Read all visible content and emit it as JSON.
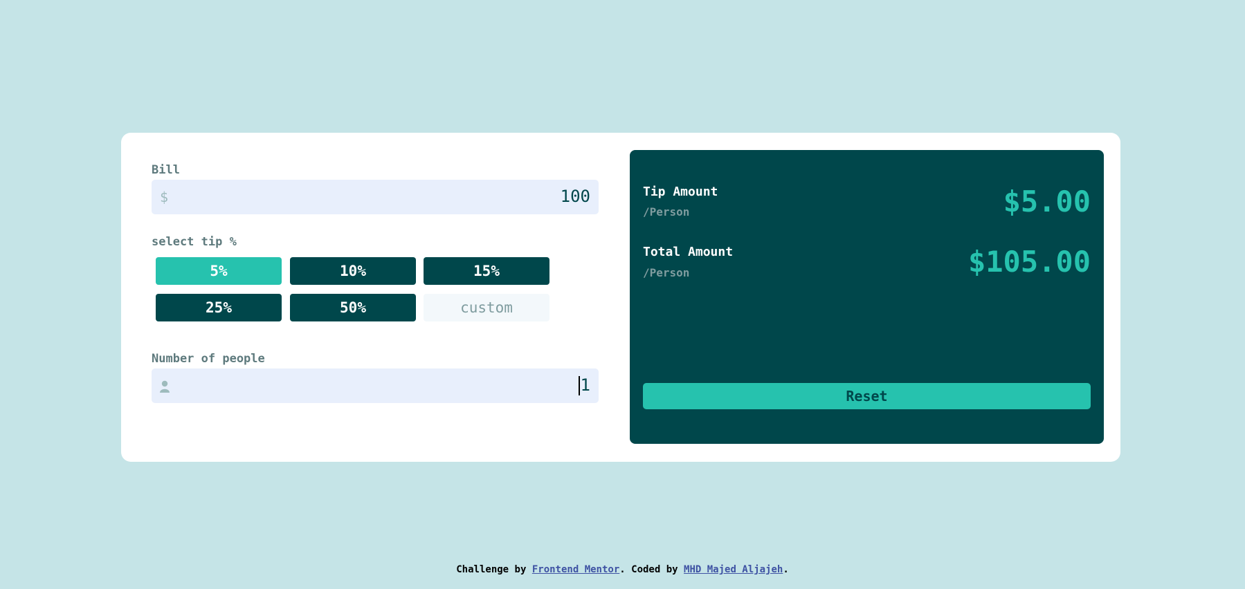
{
  "bill": {
    "label": "Bill",
    "icon": "dollar-icon",
    "icon_glyph": "$",
    "value": "100"
  },
  "tip": {
    "label": "select tip %",
    "options": [
      "5%",
      "10%",
      "15%",
      "25%",
      "50%"
    ],
    "selected": "5%",
    "custom_placeholder": "custom"
  },
  "people": {
    "label": "Number of people",
    "icon": "person-icon",
    "value": "1"
  },
  "results": {
    "tip_amount": {
      "title": "Tip Amount",
      "sub": "/Person",
      "value": "$5.00"
    },
    "total_amount": {
      "title": "Total Amount",
      "sub": "/Person",
      "value": "$105.00"
    },
    "reset_label": "Reset"
  },
  "footer": {
    "prefix": "Challenge by",
    "link1": "Frontend Mentor",
    "middle": ". Coded by",
    "link2": "MHD Majed Aljajeh",
    "suffix": "."
  },
  "colors": {
    "background": "#c5e4e7",
    "dark_cyan": "#00474b",
    "strong_cyan": "#26c2ae",
    "input_bg": "#e8effc"
  }
}
